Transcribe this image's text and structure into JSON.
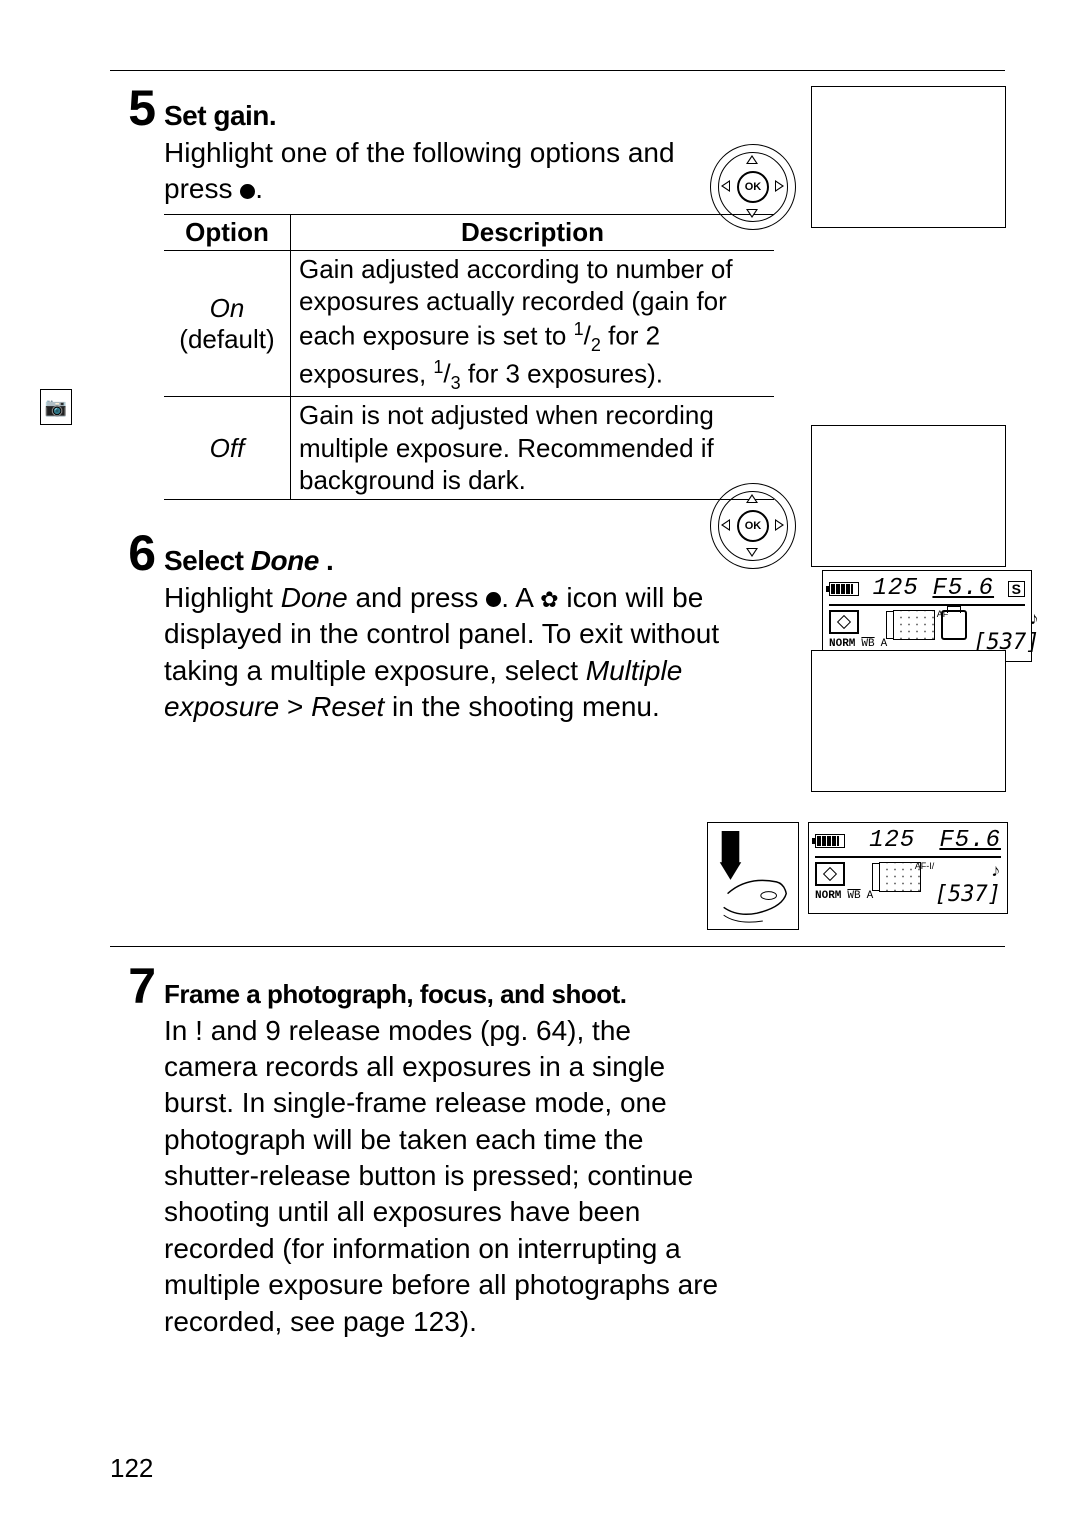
{
  "page_number": "122",
  "step5": {
    "number": "5",
    "title": "Set gain.",
    "intro_a": "Highlight one of the following options and press",
    "intro_b": ".",
    "table": {
      "head_option": "Option",
      "head_desc": "Description",
      "rows": [
        {
          "option_a": "On",
          "option_b": "(default)",
          "desc_a": "Gain adjusted according to number of exposures actually recorded (gain for each exposure is set to ",
          "half_n": "1",
          "half_d": "2",
          "desc_b": " for 2 exposures, ",
          "third_n": "1",
          "third_d": "3",
          "desc_c": " for 3 exposures)."
        },
        {
          "option_a": "Off",
          "option_b": "",
          "desc_a": "Gain is not adjusted when recording multiple exposure.  Recommended if background is dark."
        }
      ]
    }
  },
  "step6": {
    "number": "6",
    "title_a": "Select ",
    "title_b": "Done",
    "title_c": " .",
    "body_a": "Highlight ",
    "body_b": "Done",
    "body_c": " and press ",
    "body_d": ".  A ",
    "body_e": " icon will be displayed in the control panel.  To exit without taking a multiple exposure, select ",
    "body_f": "Multiple exposure",
    "body_g": " > ",
    "body_h": "Reset",
    "body_i": " in the shooting menu."
  },
  "step7": {
    "number": "7",
    "title": "Frame a photograph, focus, and shoot.",
    "body_a": "In ",
    "mode1": "!",
    "body_b": " and ",
    "mode2": "9",
    "body_c": " release modes (pg. 64), the camera records all exposures in a single burst.  In single-frame release mode, one photograph will be taken each time the shutter-release button is pressed; continue shooting until all exposures have been recorded (for information on interrupting a multiple exposure before all photographs are recorded, see page 123)."
  },
  "lcd": {
    "shutter": "125",
    "aperture": "F5.6",
    "mode_box": "S",
    "af_label": "AF",
    "beep": "♪",
    "norm": "NORM",
    "wb": "WB",
    "wb_a": "A",
    "remaining": "[537]"
  },
  "lcd2": {
    "shutter": "125",
    "aperture": "F5.6",
    "af_label": "AF-I/",
    "beep": "♪",
    "norm": "NORM",
    "wb": "WB",
    "wb_a": "A",
    "remaining": "[537]"
  },
  "dpad_ok": "OK",
  "margin_icon": "📷"
}
